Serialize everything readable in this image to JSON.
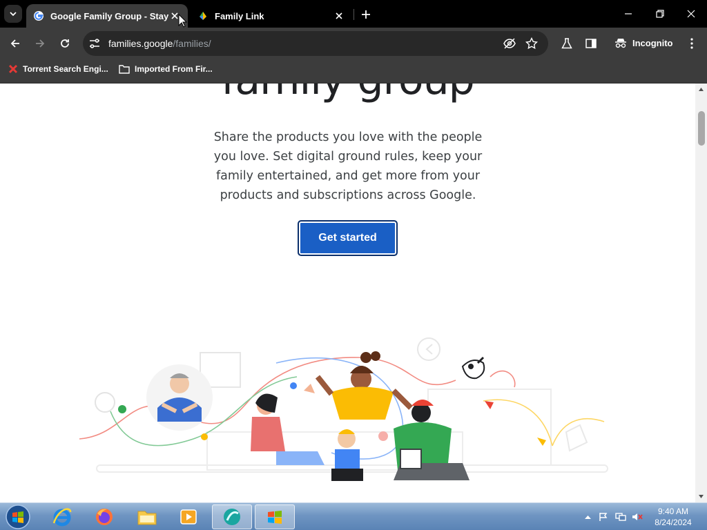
{
  "browser": {
    "tabs": [
      {
        "title": "Google Family Group - Stay Co",
        "active": true
      },
      {
        "title": "Family Link",
        "active": false
      }
    ],
    "address": {
      "domain": "families.google",
      "path": "/families/"
    },
    "profile_label": "Incognito",
    "bookmarks": [
      {
        "label": "Torrent Search Engi..."
      },
      {
        "label": "Imported From Fir..."
      }
    ]
  },
  "page": {
    "heading": "family group",
    "description": "Share the products you love with the people you love. Set digital ground rules, keep your family entertained, and get more from your products and subscriptions across Google.",
    "cta_label": "Get started"
  },
  "taskbar": {
    "clock_time": "9:40 AM",
    "clock_date": "8/24/2024"
  },
  "colors": {
    "cta": "#1a5fc5",
    "toolbar": "#3c3c3c",
    "tabstrip": "#000000"
  }
}
